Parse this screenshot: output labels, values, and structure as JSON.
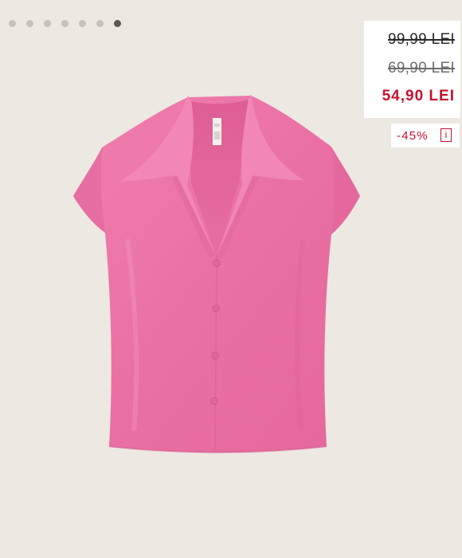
{
  "gallery": {
    "dots": [
      {
        "active": false
      },
      {
        "active": false
      },
      {
        "active": false
      },
      {
        "active": false
      },
      {
        "active": false
      },
      {
        "active": false
      },
      {
        "active": true
      }
    ]
  },
  "pricing": {
    "original_price": "99,99 LEI",
    "previous_price": "69,90 LEI",
    "current_price": "54,90 LEI",
    "discount": "-45%",
    "info_glyph": "i"
  },
  "colors": {
    "background": "#ede8e2",
    "sale_red": "#c8102e",
    "shirt_pink": "#ec77a8"
  },
  "product": {
    "image_subject": "pink-satin-short-sleeve-shirt"
  }
}
